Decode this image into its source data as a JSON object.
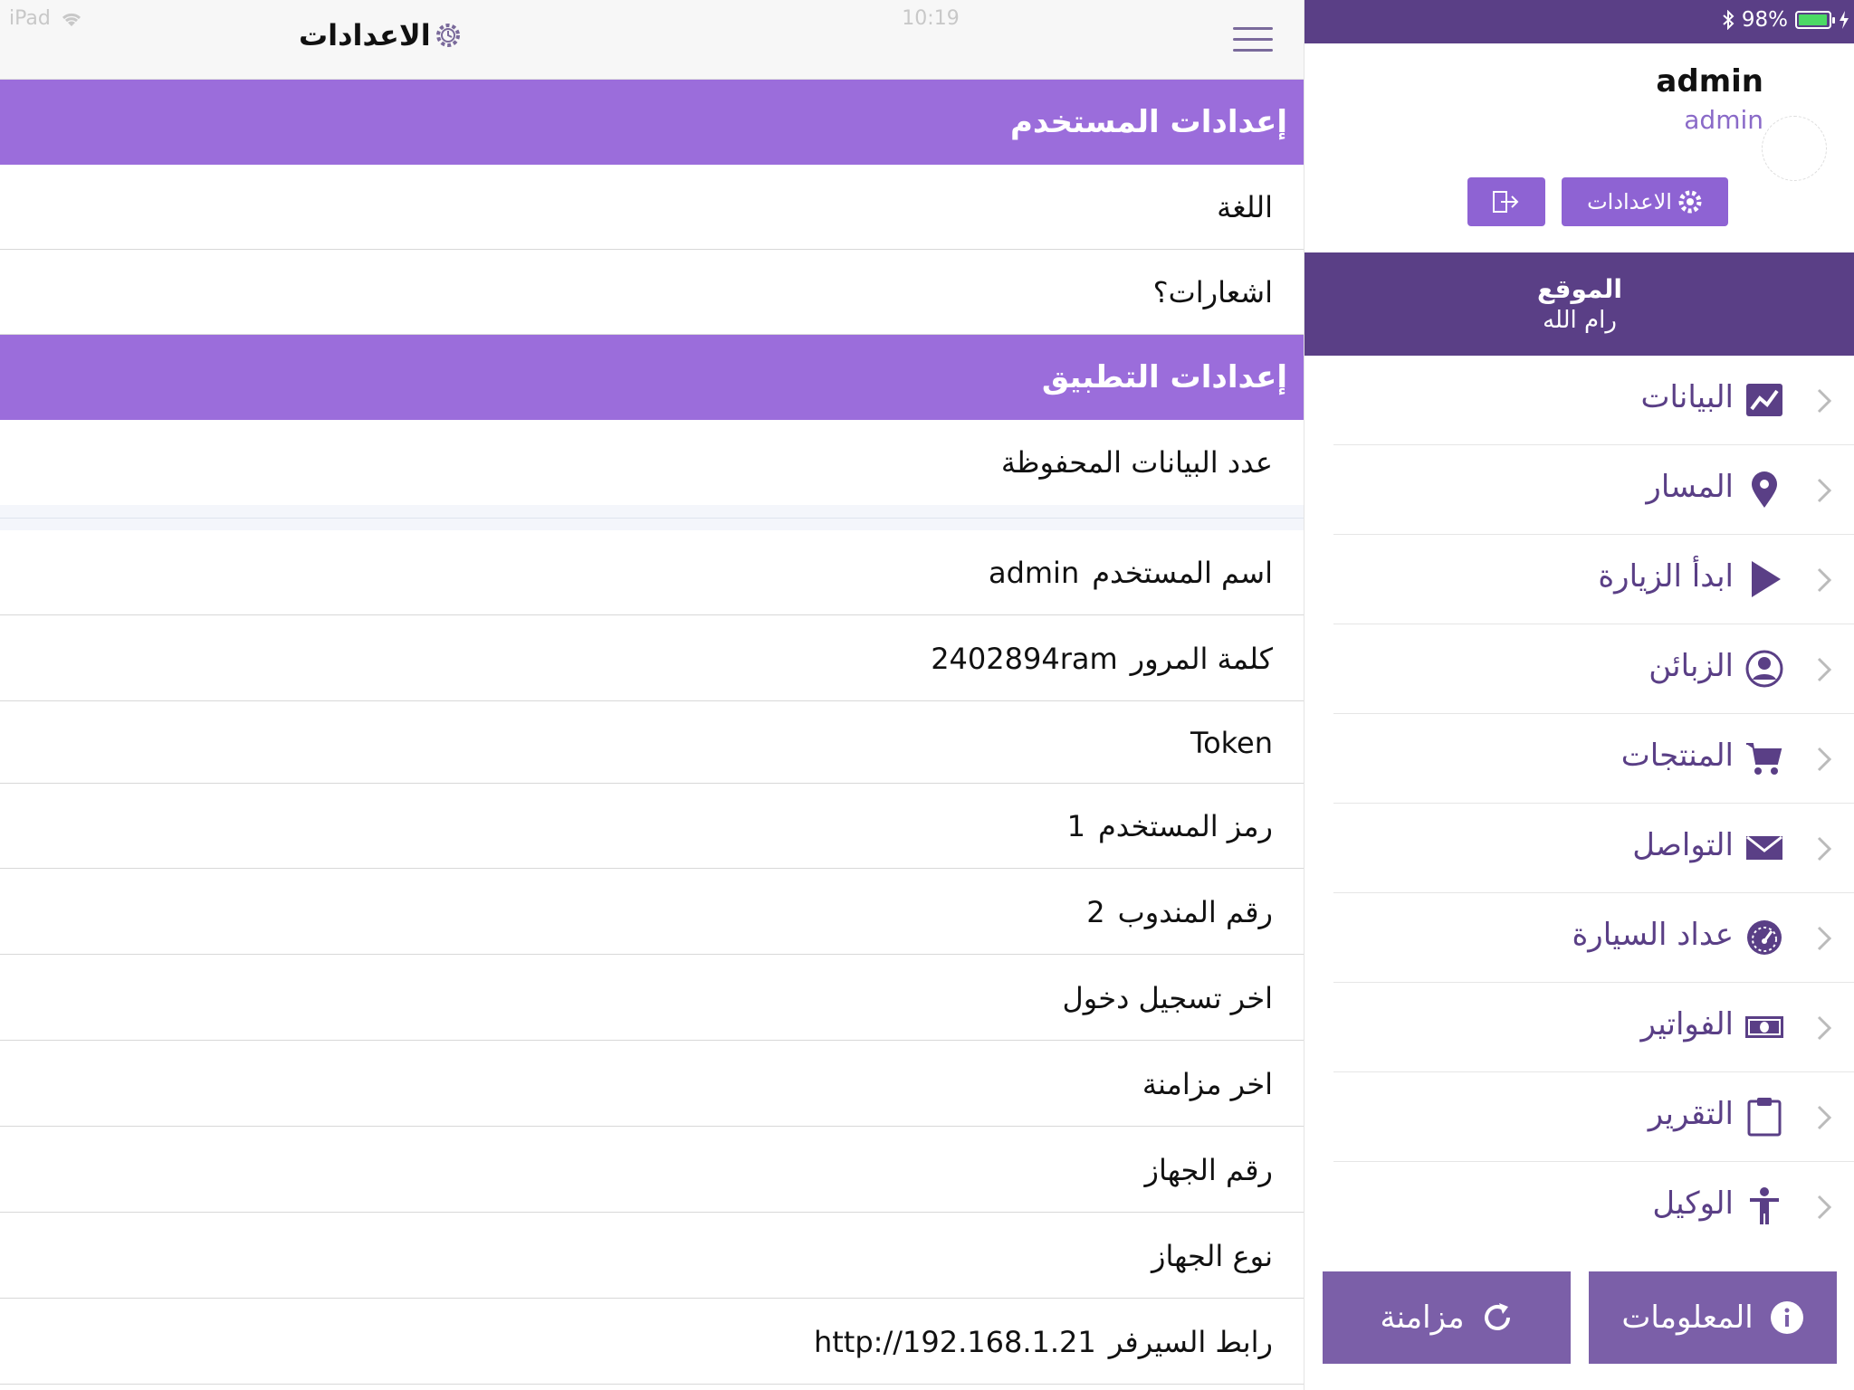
{
  "status_bar": {
    "device": "iPad",
    "time": "10:19",
    "battery_percent_label": "98%",
    "battery_level": 0.98
  },
  "header": {
    "title": "الاعدادات"
  },
  "sections": {
    "user_settings": "إعدادات المستخدم",
    "app_settings": "إعدادات التطبيق"
  },
  "user_rows": [
    {
      "label": "اللغة",
      "value": ""
    },
    {
      "label": "اشعارات؟",
      "value": ""
    }
  ],
  "app_rows": [
    {
      "label": "عدد البيانات المحفوظة",
      "value": ""
    }
  ],
  "info_rows": [
    {
      "label": "اسم المستخدم",
      "value": "admin"
    },
    {
      "label": "كلمة المرور",
      "value": "2402894ram"
    },
    {
      "label": "Token",
      "value": ""
    },
    {
      "label": "رمز المستخدم",
      "value": "1"
    },
    {
      "label": "رقم المندوب",
      "value": "2"
    },
    {
      "label": "اخر تسجيل دخول",
      "value": ""
    },
    {
      "label": "اخر مزامنة",
      "value": ""
    },
    {
      "label": "رقم الجهاز",
      "value": ""
    },
    {
      "label": "نوع الجهاز",
      "value": ""
    },
    {
      "label": "رابط السيرفر",
      "value": "http://192.168.1.21"
    }
  ],
  "drawer": {
    "profile_name": "admin",
    "profile_role": "admin",
    "settings_button": "الاعدادات",
    "location_label": "الموقع",
    "location_value": "رام الله",
    "menu": [
      {
        "label": "البيانات",
        "icon": "chart-line-icon"
      },
      {
        "label": "المسار",
        "icon": "map-pin-icon"
      },
      {
        "label": "ابدأ الزيارة",
        "icon": "play-icon"
      },
      {
        "label": "الزبائن",
        "icon": "user-circle-icon"
      },
      {
        "label": "المنتجات",
        "icon": "cart-icon"
      },
      {
        "label": "التواصل",
        "icon": "envelope-icon"
      },
      {
        "label": "عداد السيارة",
        "icon": "speedometer-icon"
      },
      {
        "label": "الفواتير",
        "icon": "money-icon"
      },
      {
        "label": "التقرير",
        "icon": "clipboard-icon"
      },
      {
        "label": "الوكيل",
        "icon": "person-icon"
      }
    ],
    "info_button": "المعلومات",
    "sync_button": "مزامنة"
  },
  "colors": {
    "section_header": "#9b6ddb",
    "drawer_dark": "#5a3f86",
    "accent_button": "#8e63d3",
    "bottom_button": "#7b5fa8"
  }
}
